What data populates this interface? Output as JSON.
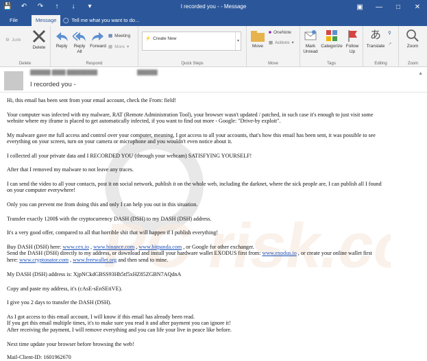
{
  "window": {
    "title": "I recorded you - - Message"
  },
  "tabs": {
    "file": "File",
    "message": "Message",
    "tell_me": "Tell me what you want to do..."
  },
  "ribbon": {
    "delete_group": {
      "junk": "Junk",
      "delete": "Delete",
      "label": "Delete"
    },
    "respond_group": {
      "reply": "Reply",
      "reply_all_1": "Reply",
      "reply_all_2": "All",
      "forward": "Forward",
      "meeting": "Meeting",
      "more": "More",
      "label": "Respond"
    },
    "quick_steps": {
      "create_new": "Create New",
      "label": "Quick Steps"
    },
    "move_group": {
      "move": "Move",
      "onenote": "OneNote",
      "actions": "Actions",
      "label": "Move"
    },
    "tags_group": {
      "mark_unread_1": "Mark",
      "mark_unread_2": "Unread",
      "categorize": "Categorize",
      "follow_up_1": "Follow",
      "follow_up_2": "Up",
      "label": "Tags"
    },
    "editing_group": {
      "translate": "Translate",
      "label": "Editing"
    },
    "zoom_group": {
      "zoom": "Zoom",
      "label": "Zoom"
    }
  },
  "header": {
    "subject": "I recorded you -"
  },
  "body": {
    "p1": "Hi, this email has been sent from your email account, check the From: field!",
    "p2a": "Your computer was infected with my malware, RAT (Remote Administration Tool), your browser wasn't updated / patched, in such case it's enough to just visit some",
    "p2b": "website where my iframe is placed to get automatically infected, if you want to find out more - Google: \"Drive-by exploit\".",
    "p3a": "My malware gave me full access and control over your computer, meaning, I got access to all your accounts, that's how this email has been sent, it was possible to see",
    "p3b": "everything on your screen, turn on your camera or microphone and you wouldn't even notice about it.",
    "p4": "I collected all your private data and I RECORDED YOU (through your webcam) SATISFYING YOURSELF!",
    "p5": "After that I removed my malware to not leave any traces.",
    "p6a": "I can send the video to all your contacts, post it on social network, publish it on the whole web, including the darknet, where the sick people are, I can publish all I found",
    "p6b": "on your computer everywhere!",
    "p7": "Only you can prevent me from doing this and only I can help you out in this situation.",
    "p8": "Transfer exactly 1200$ with the cryptocurrency DASH (DSH) to my DASH (DSH) address.",
    "p9": "It's a very good offer, compared to all that horrible shit that will happen if I publish everything!",
    "p10_pre": "Buy DASH (DSH) here: ",
    "link_cex": "www.cex.io",
    "sep1": " , ",
    "link_binance": "www.binance.com",
    "sep2": " , ",
    "link_bitpanda": "www.bitpanda.com",
    "p10_post": " , or Google for other exchanger.",
    "p11_pre": "Send the DASH (DSH) directly to my address, or download and install your hardware wallet EXODUS first from: ",
    "link_exodus": "www.exodus.io",
    "p11_post": " , or create your online wallet first",
    "p12_pre": "here: ",
    "link_cryptonator": "www.cryptonator.com",
    "sep3": " , ",
    "link_freewallet": "www.freewallet.org",
    "p12_post": " and then send to mine.",
    "p13": "My DASH (DSH) address is: XjpNCkdGBSS93Hh5tf5xHZ85ZGBN7AQdnA",
    "p14": "Copy and paste my address, it's (cAsE-sEnSEtiVE).",
    "p15": "I give you 2 days to transfer the DASH (DSH).",
    "p16a": "As I got access to this email account, I will know if this email has already been read.",
    "p16b": "If you get this email multiple times, it's to make sure you read it and after payment you can ignore it!",
    "p16c": "After receiving the payment, I will remove everything and you can life your live in peace like before.",
    "p17": "Next time update your browser before browsing the web!",
    "p18": "Mail-Client-ID: 1601962670"
  },
  "watermark": {
    "text": "PC risk.com"
  }
}
